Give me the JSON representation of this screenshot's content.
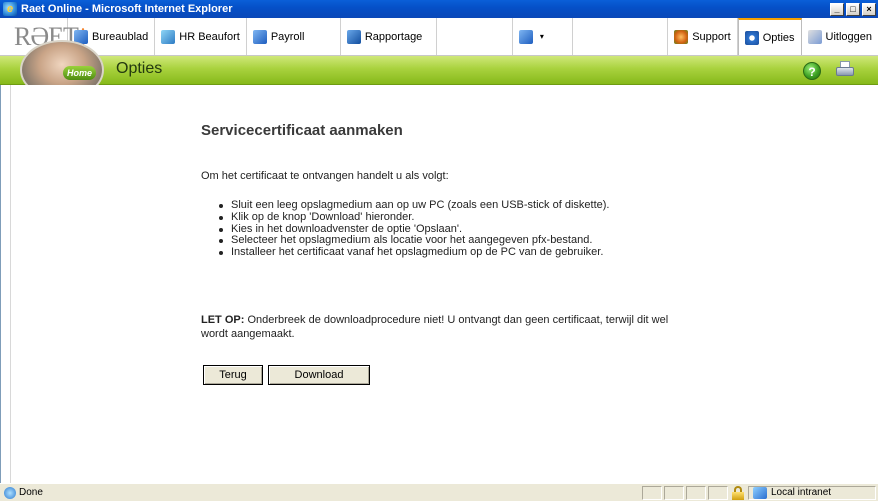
{
  "window": {
    "title": "Raet Online - Microsoft Internet Explorer",
    "minimize": "_",
    "maximize": "□",
    "close": "×"
  },
  "brand": {
    "logo_text": "RƏET",
    "badge": "!"
  },
  "nav": {
    "tabs": [
      {
        "label": "Bureaublad",
        "icon": "desktop-icon"
      },
      {
        "label": "HR Beaufort",
        "icon": "hr-icon"
      },
      {
        "label": "Payroll",
        "icon": "payroll-icon"
      },
      {
        "label": "Rapportage",
        "icon": "report-icon"
      }
    ],
    "dropdown_caret": "▾",
    "right_tabs": [
      {
        "label": "Support",
        "icon": "support-icon"
      },
      {
        "label": "Opties",
        "icon": "options-icon",
        "active": true
      },
      {
        "label": "Uitloggen",
        "icon": "logout-icon"
      }
    ]
  },
  "band": {
    "home_label": "Home",
    "section_title": "Opties",
    "help_symbol": "?"
  },
  "content": {
    "title": "Servicecertificaat aanmaken",
    "intro": "Om het certificaat te ontvangen handelt u als volgt:",
    "steps": [
      "Sluit een leeg opslagmedium aan op uw PC (zoals een USB-stick of diskette).",
      "Klik op de knop 'Download' hieronder.",
      "Kies in het downloadvenster de optie 'Opslaan'.",
      "Selecteer het opslagmedium als locatie voor het aangegeven pfx-bestand.",
      "Installeer het certificaat vanaf het opslagmedium op de PC van de gebruiker."
    ],
    "notice_label": "LET OP:",
    "notice_text": " Onderbreek de downloadprocedure niet! U ontvangt dan geen certificaat, terwijl dit wel wordt aangemaakt.",
    "buttons": {
      "back": "Terug",
      "download": "Download"
    }
  },
  "status": {
    "text": "Done",
    "zone": "Local intranet"
  }
}
